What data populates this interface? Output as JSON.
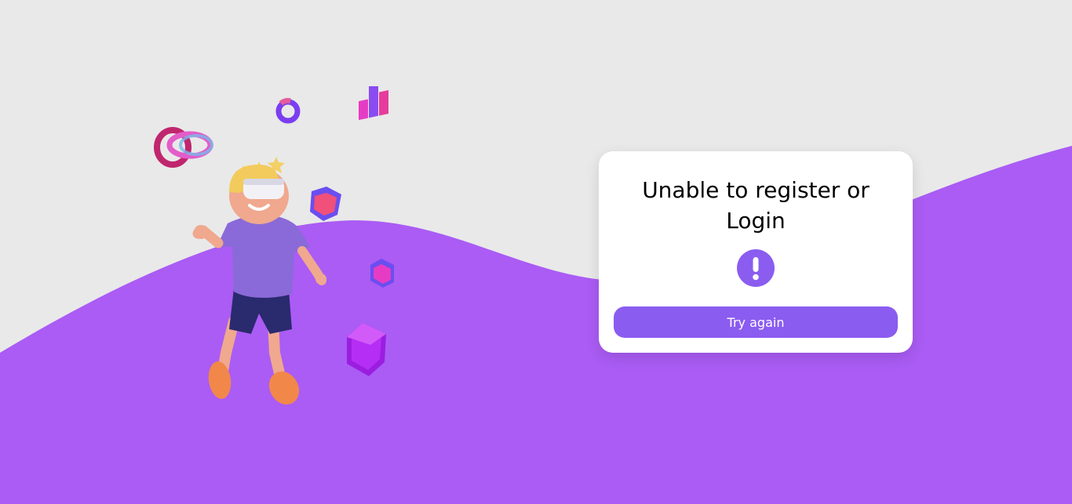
{
  "colors": {
    "background": "#e9e9e9",
    "wave": "#aa5cf4",
    "card": "#ffffff",
    "accent": "#8b5cf0"
  },
  "dialog": {
    "title": "Unable to register or Login",
    "icon": "exclamation-icon",
    "button_label": "Try again"
  },
  "illustration": {
    "subject": "vr-boy-illustration"
  }
}
